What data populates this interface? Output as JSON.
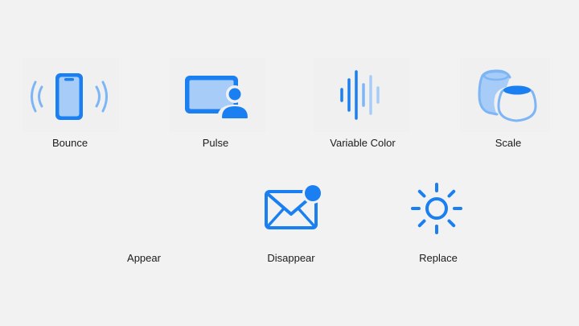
{
  "colors": {
    "accent": "#1a7ff0",
    "accent_light": "#7db5f5",
    "accent_fill": "#a8ccf8",
    "background": "#f2f2f3",
    "text": "#1c1c1e"
  },
  "effects": [
    {
      "label": "Bounce",
      "icon": "iphone-radiowaves-icon"
    },
    {
      "label": "Pulse",
      "icon": "rectangle-inset-person-icon"
    },
    {
      "label": "Variable Color",
      "icon": "waveform-icon"
    },
    {
      "label": "Scale",
      "icon": "homepod-pair-icon"
    },
    {
      "label": "Appear",
      "icon": ""
    },
    {
      "label": "Disappear",
      "icon": "envelope-badge-icon"
    },
    {
      "label": "Replace",
      "icon": "sun-icon"
    }
  ]
}
